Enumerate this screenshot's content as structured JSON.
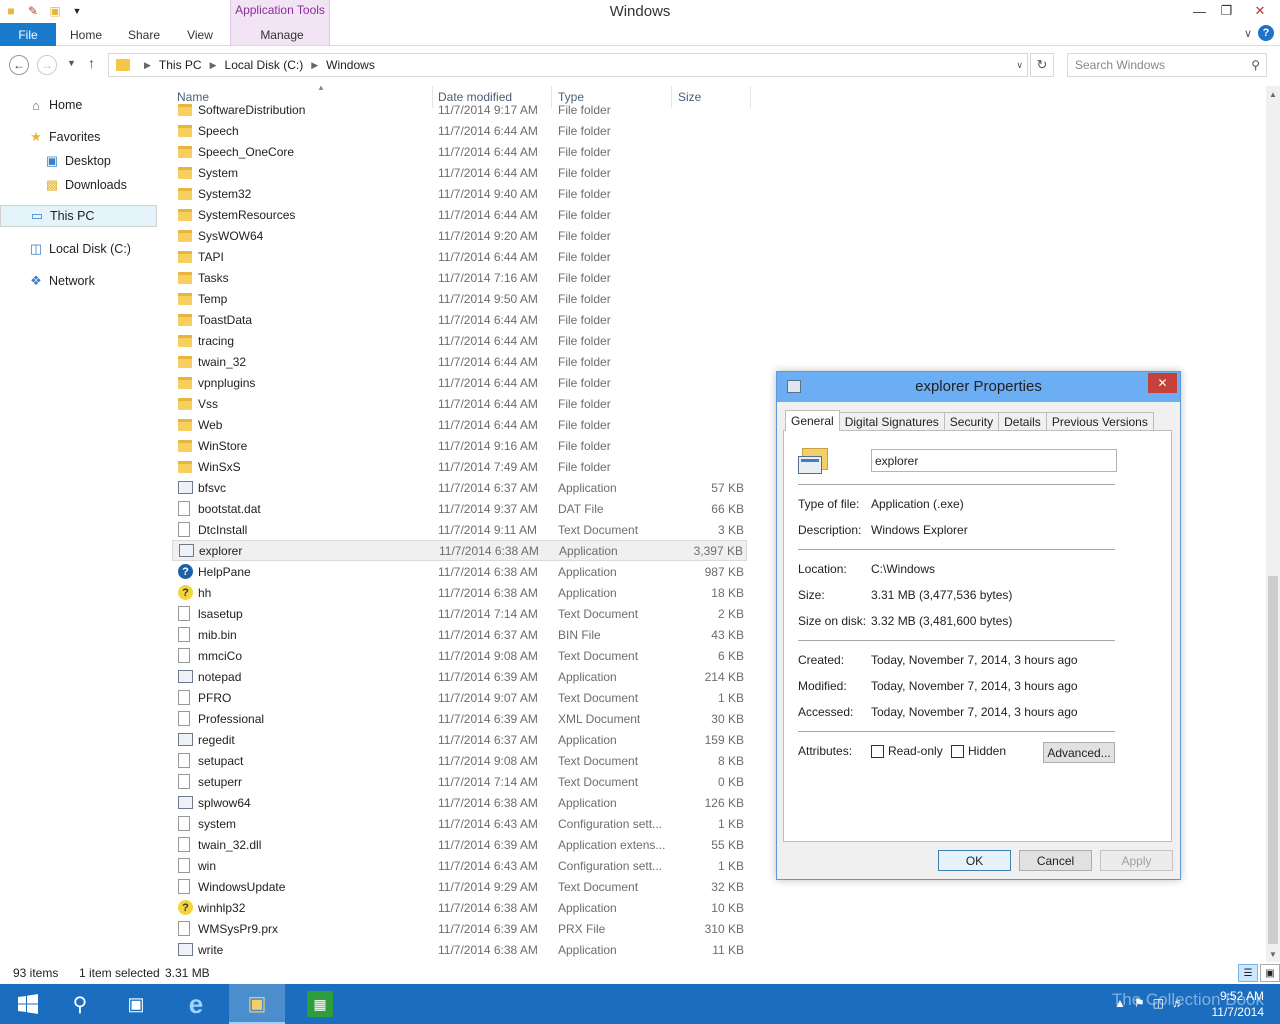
{
  "window": {
    "title": "Windows",
    "contextual_tab_group": "Application Tools"
  },
  "ribbon": {
    "tabs": [
      "File",
      "Home",
      "Share",
      "View",
      "Manage"
    ]
  },
  "address": {
    "breadcrumbs": [
      "This PC",
      "Local Disk (C:)",
      "Windows"
    ],
    "search_placeholder": "Search Windows"
  },
  "nav": {
    "home": "Home",
    "favorites": "Favorites",
    "desktop": "Desktop",
    "downloads": "Downloads",
    "this_pc": "This PC",
    "local_disk": "Local Disk (C:)",
    "network": "Network"
  },
  "columns": {
    "name": "Name",
    "date": "Date modified",
    "type": "Type",
    "size": "Size"
  },
  "files": [
    {
      "name": "SoftwareDistribution",
      "date": "11/7/2014 9:17 AM",
      "type": "File folder",
      "size": "",
      "icon": "folder"
    },
    {
      "name": "Speech",
      "date": "11/7/2014 6:44 AM",
      "type": "File folder",
      "size": "",
      "icon": "folder"
    },
    {
      "name": "Speech_OneCore",
      "date": "11/7/2014 6:44 AM",
      "type": "File folder",
      "size": "",
      "icon": "folder"
    },
    {
      "name": "System",
      "date": "11/7/2014 6:44 AM",
      "type": "File folder",
      "size": "",
      "icon": "folder"
    },
    {
      "name": "System32",
      "date": "11/7/2014 9:40 AM",
      "type": "File folder",
      "size": "",
      "icon": "folder"
    },
    {
      "name": "SystemResources",
      "date": "11/7/2014 6:44 AM",
      "type": "File folder",
      "size": "",
      "icon": "folder"
    },
    {
      "name": "SysWOW64",
      "date": "11/7/2014 9:20 AM",
      "type": "File folder",
      "size": "",
      "icon": "folder"
    },
    {
      "name": "TAPI",
      "date": "11/7/2014 6:44 AM",
      "type": "File folder",
      "size": "",
      "icon": "folder"
    },
    {
      "name": "Tasks",
      "date": "11/7/2014 7:16 AM",
      "type": "File folder",
      "size": "",
      "icon": "folder"
    },
    {
      "name": "Temp",
      "date": "11/7/2014 9:50 AM",
      "type": "File folder",
      "size": "",
      "icon": "folder"
    },
    {
      "name": "ToastData",
      "date": "11/7/2014 6:44 AM",
      "type": "File folder",
      "size": "",
      "icon": "folder"
    },
    {
      "name": "tracing",
      "date": "11/7/2014 6:44 AM",
      "type": "File folder",
      "size": "",
      "icon": "folder"
    },
    {
      "name": "twain_32",
      "date": "11/7/2014 6:44 AM",
      "type": "File folder",
      "size": "",
      "icon": "folder"
    },
    {
      "name": "vpnplugins",
      "date": "11/7/2014 6:44 AM",
      "type": "File folder",
      "size": "",
      "icon": "folder"
    },
    {
      "name": "Vss",
      "date": "11/7/2014 6:44 AM",
      "type": "File folder",
      "size": "",
      "icon": "folder"
    },
    {
      "name": "Web",
      "date": "11/7/2014 6:44 AM",
      "type": "File folder",
      "size": "",
      "icon": "folder"
    },
    {
      "name": "WinStore",
      "date": "11/7/2014 9:16 AM",
      "type": "File folder",
      "size": "",
      "icon": "folder"
    },
    {
      "name": "WinSxS",
      "date": "11/7/2014 7:49 AM",
      "type": "File folder",
      "size": "",
      "icon": "folder"
    },
    {
      "name": "bfsvc",
      "date": "11/7/2014 6:37 AM",
      "type": "Application",
      "size": "57 KB",
      "icon": "app"
    },
    {
      "name": "bootstat.dat",
      "date": "11/7/2014 9:37 AM",
      "type": "DAT File",
      "size": "66 KB",
      "icon": "file"
    },
    {
      "name": "DtcInstall",
      "date": "11/7/2014 9:11 AM",
      "type": "Text Document",
      "size": "3 KB",
      "icon": "file"
    },
    {
      "name": "explorer",
      "date": "11/7/2014 6:38 AM",
      "type": "Application",
      "size": "3,397 KB",
      "icon": "app",
      "selected": true
    },
    {
      "name": "HelpPane",
      "date": "11/7/2014 6:38 AM",
      "type": "Application",
      "size": "987 KB",
      "icon": "help"
    },
    {
      "name": "hh",
      "date": "11/7/2014 6:38 AM",
      "type": "Application",
      "size": "18 KB",
      "icon": "hh"
    },
    {
      "name": "lsasetup",
      "date": "11/7/2014 7:14 AM",
      "type": "Text Document",
      "size": "2 KB",
      "icon": "file"
    },
    {
      "name": "mib.bin",
      "date": "11/7/2014 6:37 AM",
      "type": "BIN File",
      "size": "43 KB",
      "icon": "file"
    },
    {
      "name": "mmciCo",
      "date": "11/7/2014 9:08 AM",
      "type": "Text Document",
      "size": "6 KB",
      "icon": "file"
    },
    {
      "name": "notepad",
      "date": "11/7/2014 6:39 AM",
      "type": "Application",
      "size": "214 KB",
      "icon": "app"
    },
    {
      "name": "PFRO",
      "date": "11/7/2014 9:07 AM",
      "type": "Text Document",
      "size": "1 KB",
      "icon": "file"
    },
    {
      "name": "Professional",
      "date": "11/7/2014 6:39 AM",
      "type": "XML Document",
      "size": "30 KB",
      "icon": "file"
    },
    {
      "name": "regedit",
      "date": "11/7/2014 6:37 AM",
      "type": "Application",
      "size": "159 KB",
      "icon": "app"
    },
    {
      "name": "setupact",
      "date": "11/7/2014 9:08 AM",
      "type": "Text Document",
      "size": "8 KB",
      "icon": "file"
    },
    {
      "name": "setuperr",
      "date": "11/7/2014 7:14 AM",
      "type": "Text Document",
      "size": "0 KB",
      "icon": "file"
    },
    {
      "name": "splwow64",
      "date": "11/7/2014 6:38 AM",
      "type": "Application",
      "size": "126 KB",
      "icon": "app"
    },
    {
      "name": "system",
      "date": "11/7/2014 6:43 AM",
      "type": "Configuration sett...",
      "size": "1 KB",
      "icon": "file"
    },
    {
      "name": "twain_32.dll",
      "date": "11/7/2014 6:39 AM",
      "type": "Application extens...",
      "size": "55 KB",
      "icon": "file"
    },
    {
      "name": "win",
      "date": "11/7/2014 6:43 AM",
      "type": "Configuration sett...",
      "size": "1 KB",
      "icon": "file"
    },
    {
      "name": "WindowsUpdate",
      "date": "11/7/2014 9:29 AM",
      "type": "Text Document",
      "size": "32 KB",
      "icon": "file"
    },
    {
      "name": "winhlp32",
      "date": "11/7/2014 6:38 AM",
      "type": "Application",
      "size": "10 KB",
      "icon": "hh"
    },
    {
      "name": "WMSysPr9.prx",
      "date": "11/7/2014 6:39 AM",
      "type": "PRX File",
      "size": "310 KB",
      "icon": "file"
    },
    {
      "name": "write",
      "date": "11/7/2014 6:38 AM",
      "type": "Application",
      "size": "11 KB",
      "icon": "app"
    }
  ],
  "status": {
    "items": "93 items",
    "selected": "1 item selected",
    "size": "3.31 MB"
  },
  "dialog": {
    "title": "explorer Properties",
    "tabs": [
      "General",
      "Digital Signatures",
      "Security",
      "Details",
      "Previous Versions"
    ],
    "name_value": "explorer",
    "type_label": "Type of file:",
    "type_value": "Application (.exe)",
    "desc_label": "Description:",
    "desc_value": "Windows Explorer",
    "location_label": "Location:",
    "location_value": "C:\\Windows",
    "size_label": "Size:",
    "size_value": "3.31 MB (3,477,536 bytes)",
    "disk_label": "Size on disk:",
    "disk_value": "3.32 MB (3,481,600 bytes)",
    "created_label": "Created:",
    "created_value": "Today, November 7, 2014, 3 hours ago",
    "modified_label": "Modified:",
    "modified_value": "Today, November 7, 2014, 3 hours ago",
    "accessed_label": "Accessed:",
    "accessed_value": "Today, November 7, 2014, 3 hours ago",
    "attributes_label": "Attributes:",
    "readonly_label": "Read-only",
    "hidden_label": "Hidden",
    "advanced_label": "Advanced...",
    "ok_label": "OK",
    "cancel_label": "Cancel",
    "apply_label": "Apply"
  },
  "taskbar": {
    "time": "9:52 AM",
    "date": "11/7/2014",
    "watermark": "The Collection Book"
  }
}
